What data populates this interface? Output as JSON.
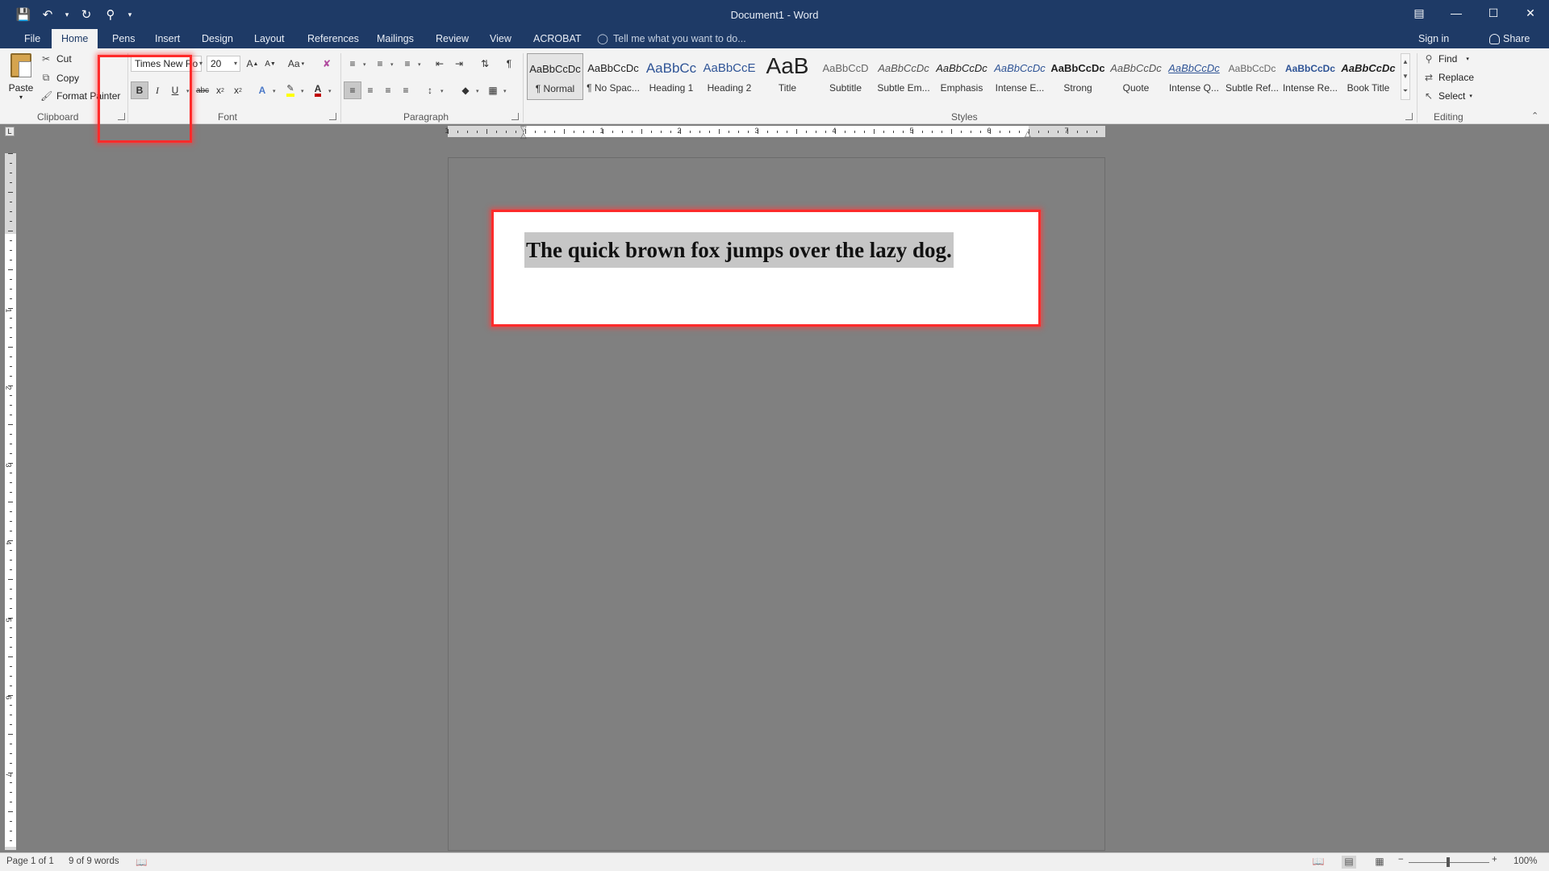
{
  "window": {
    "title": "Document1 - Word"
  },
  "quick_access": {
    "icons": [
      "save-icon",
      "undo-icon",
      "redo-icon",
      "touch-mode-icon",
      "customize-icon"
    ]
  },
  "tabs": [
    {
      "label": "File"
    },
    {
      "label": "Home"
    },
    {
      "label": "Pens"
    },
    {
      "label": "Insert"
    },
    {
      "label": "Design"
    },
    {
      "label": "Layout"
    },
    {
      "label": "References"
    },
    {
      "label": "Mailings"
    },
    {
      "label": "Review"
    },
    {
      "label": "View"
    },
    {
      "label": "ACROBAT"
    }
  ],
  "active_tab": "Home",
  "tell_me": {
    "placeholder": "Tell me what you want to do..."
  },
  "account": {
    "sign_in": "Sign in",
    "share": "Share"
  },
  "clipboard": {
    "paste": "Paste",
    "cut": "Cut",
    "copy": "Copy",
    "format_painter": "Format Painter",
    "label": "Clipboard"
  },
  "font": {
    "name": "Times New Ro",
    "size": "20",
    "grow": "A",
    "shrink": "A",
    "change_case": "Aa",
    "bold": "B",
    "italic": "I",
    "underline": "U",
    "strikethrough": "abc",
    "subscript": "x",
    "superscript": "x",
    "label": "Font",
    "font_color": "#c00000",
    "highlight_color": "#ffff00"
  },
  "paragraph": {
    "label": "Paragraph"
  },
  "styles": {
    "label": "Styles",
    "items": [
      {
        "sample": "AaBbCcDc",
        "name": "¶ Normal"
      },
      {
        "sample": "AaBbCcDc",
        "name": "¶ No Spac..."
      },
      {
        "sample": "AaBbCc",
        "name": "Heading 1"
      },
      {
        "sample": "AaBbCcE",
        "name": "Heading 2"
      },
      {
        "sample": "AaB",
        "name": "Title"
      },
      {
        "sample": "AaBbCcD",
        "name": "Subtitle"
      },
      {
        "sample": "AaBbCcDc",
        "name": "Subtle Em..."
      },
      {
        "sample": "AaBbCcDc",
        "name": "Emphasis"
      },
      {
        "sample": "AaBbCcDc",
        "name": "Intense E..."
      },
      {
        "sample": "AaBbCcDc",
        "name": "Strong"
      },
      {
        "sample": "AaBbCcDc",
        "name": "Quote"
      },
      {
        "sample": "AaBbCcDc",
        "name": "Intense Q..."
      },
      {
        "sample": "AaBbCcDc",
        "name": "Subtle Ref..."
      },
      {
        "sample": "AaBbCcDc",
        "name": "Intense Re..."
      },
      {
        "sample": "AaBbCcDc",
        "name": "Book Title"
      }
    ]
  },
  "editing": {
    "find": "Find",
    "replace": "Replace",
    "select": "Select",
    "label": "Editing"
  },
  "ruler": {
    "h_numbers": [
      "1",
      "1",
      "2",
      "3",
      "4",
      "5",
      "6",
      "7"
    ],
    "v_numbers": [
      "1",
      "2",
      "3",
      "4",
      "5",
      "6",
      "7"
    ]
  },
  "document": {
    "text": "The quick brown fox jumps over the lazy dog."
  },
  "status": {
    "page": "Page 1 of 1",
    "words": "9 of 9 words",
    "zoom": "100%"
  },
  "colors": {
    "title_bar": "#1e3a66",
    "ribbon": "#f3f3f3",
    "annotation": "#ff2b2b"
  }
}
